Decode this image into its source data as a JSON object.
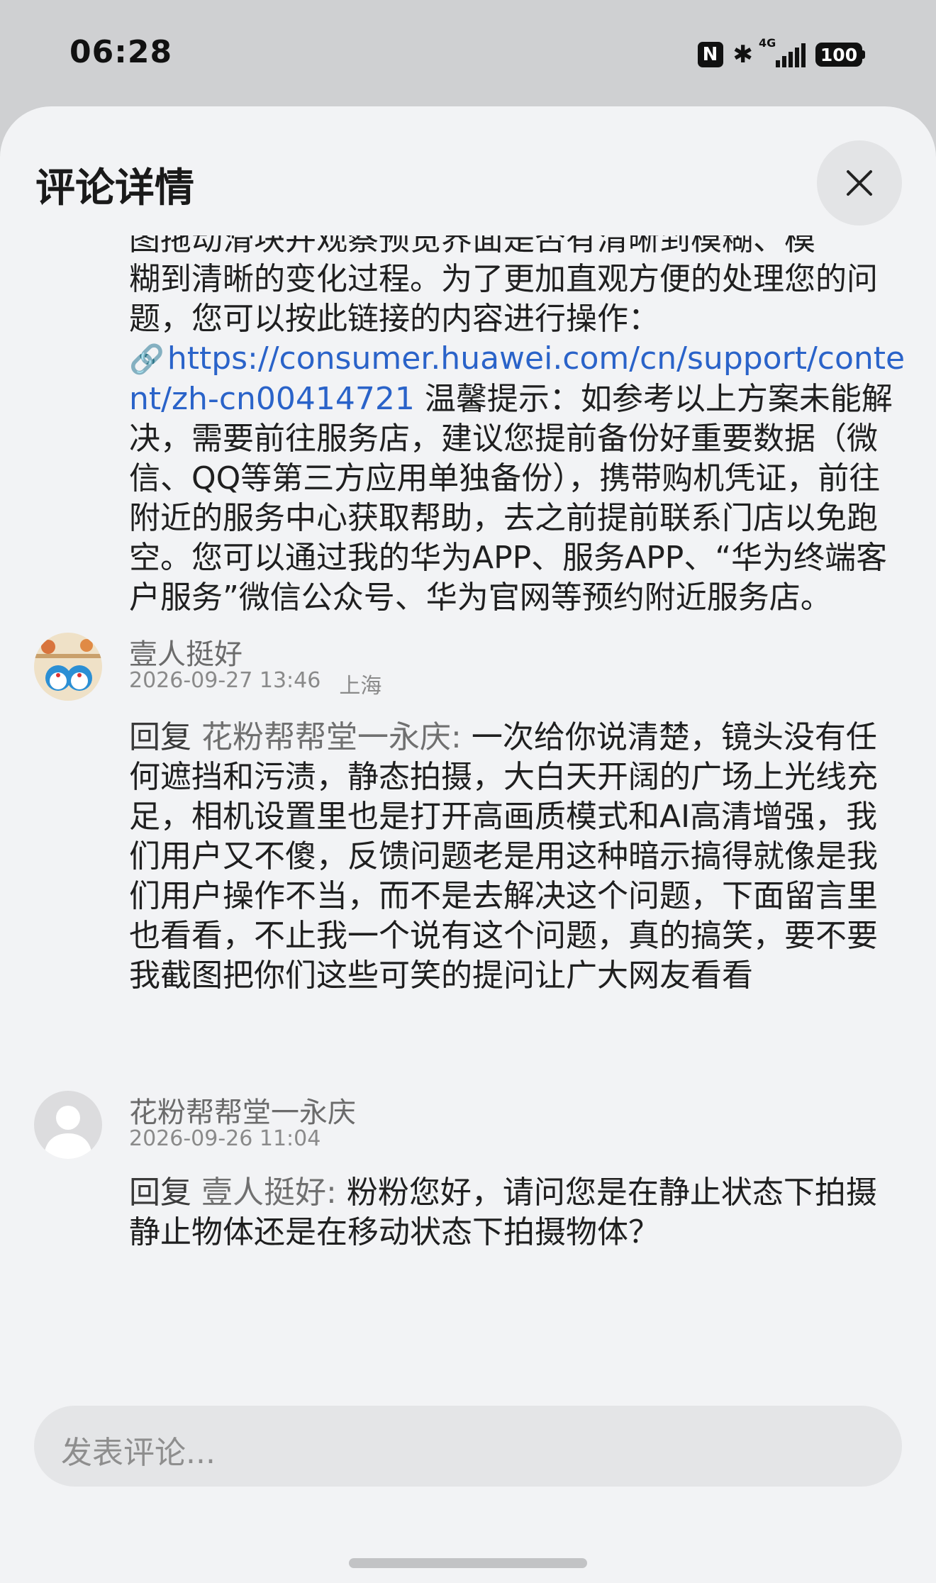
{
  "status_bar": {
    "time": "06:28",
    "network": "4G",
    "battery": "100"
  },
  "sheet": {
    "title": "评论详情",
    "close_icon": "close-icon"
  },
  "first_reply": {
    "line_top_cut": "图拖动滑块并观察预览界面是否有清晰到模糊、模",
    "text_before_link": "糊到清晰的变化过程。为了更加直观方便的处理您的问题，您可以按此链接的内容进行操作：",
    "link": "https://consumer.huawei.com/cn/support/content/zh-cn00414721",
    "text_after_link": " 温馨提示：如参考以上方案未能解决，需要前往服务店，建议您提前备份好重要数据（微信、QQ等第三方应用单独备份），携带购机凭证，前往附近的服务中心获取帮助，去之前提前联系门店以免跑空。您可以通过我的华为APP、服务APP、“华为终端客户服务”微信公众号、华为官网等预约附近服务店。"
  },
  "comments": [
    {
      "username": "壹人挺好",
      "date": "2026-09-27 13:46",
      "location": "上海",
      "reply_prefix": "回复",
      "reply_target": "花粉帮帮堂一永庆:",
      "text": "一次给你说清楚，镜头没有任何遮挡和污渍，静态拍摄，大白天开阔的广场上光线充足，相机设置里也是打开高画质模式和AI高清增强，我们用户又不傻，反馈问题老是用这种暗示搞得就像是我们用户操作不当，而不是去解决这个问题，下面留言里也看看，不止我一个说有这个问题，真的搞笑，要不要我截图把你们这些可笑的提问让广大网友看看"
    },
    {
      "username": "花粉帮帮堂一永庆",
      "date": "2026-09-26 11:04",
      "location": "",
      "reply_prefix": "回复",
      "reply_target": "壹人挺好:",
      "text": "粉粉您好，请问您是在静止状态下拍摄静止物体还是在移动状态下拍摄物体？"
    }
  ],
  "comment_input": {
    "placeholder": "发表评论..."
  }
}
